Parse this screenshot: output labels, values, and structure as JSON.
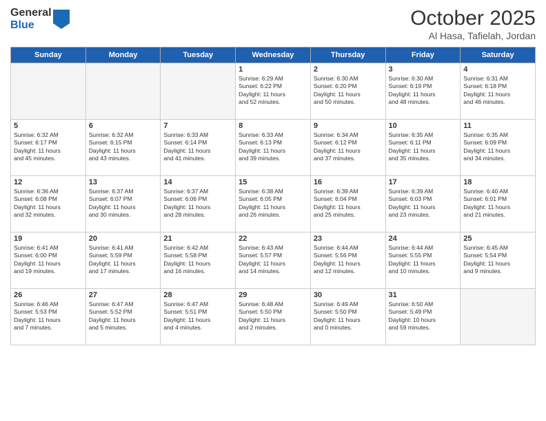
{
  "logo": {
    "general": "General",
    "blue": "Blue"
  },
  "header": {
    "month": "October 2025",
    "location": "Al Hasa, Tafielah, Jordan"
  },
  "weekdays": [
    "Sunday",
    "Monday",
    "Tuesday",
    "Wednesday",
    "Thursday",
    "Friday",
    "Saturday"
  ],
  "weeks": [
    [
      {
        "day": "",
        "info": ""
      },
      {
        "day": "",
        "info": ""
      },
      {
        "day": "",
        "info": ""
      },
      {
        "day": "1",
        "info": "Sunrise: 6:29 AM\nSunset: 6:22 PM\nDaylight: 11 hours\nand 52 minutes."
      },
      {
        "day": "2",
        "info": "Sunrise: 6:30 AM\nSunset: 6:20 PM\nDaylight: 11 hours\nand 50 minutes."
      },
      {
        "day": "3",
        "info": "Sunrise: 6:30 AM\nSunset: 6:19 PM\nDaylight: 11 hours\nand 48 minutes."
      },
      {
        "day": "4",
        "info": "Sunrise: 6:31 AM\nSunset: 6:18 PM\nDaylight: 11 hours\nand 46 minutes."
      }
    ],
    [
      {
        "day": "5",
        "info": "Sunrise: 6:32 AM\nSunset: 6:17 PM\nDaylight: 11 hours\nand 45 minutes."
      },
      {
        "day": "6",
        "info": "Sunrise: 6:32 AM\nSunset: 6:15 PM\nDaylight: 11 hours\nand 43 minutes."
      },
      {
        "day": "7",
        "info": "Sunrise: 6:33 AM\nSunset: 6:14 PM\nDaylight: 11 hours\nand 41 minutes."
      },
      {
        "day": "8",
        "info": "Sunrise: 6:33 AM\nSunset: 6:13 PM\nDaylight: 11 hours\nand 39 minutes."
      },
      {
        "day": "9",
        "info": "Sunrise: 6:34 AM\nSunset: 6:12 PM\nDaylight: 11 hours\nand 37 minutes."
      },
      {
        "day": "10",
        "info": "Sunrise: 6:35 AM\nSunset: 6:11 PM\nDaylight: 11 hours\nand 35 minutes."
      },
      {
        "day": "11",
        "info": "Sunrise: 6:35 AM\nSunset: 6:09 PM\nDaylight: 11 hours\nand 34 minutes."
      }
    ],
    [
      {
        "day": "12",
        "info": "Sunrise: 6:36 AM\nSunset: 6:08 PM\nDaylight: 11 hours\nand 32 minutes."
      },
      {
        "day": "13",
        "info": "Sunrise: 6:37 AM\nSunset: 6:07 PM\nDaylight: 11 hours\nand 30 minutes."
      },
      {
        "day": "14",
        "info": "Sunrise: 6:37 AM\nSunset: 6:06 PM\nDaylight: 11 hours\nand 28 minutes."
      },
      {
        "day": "15",
        "info": "Sunrise: 6:38 AM\nSunset: 6:05 PM\nDaylight: 11 hours\nand 26 minutes."
      },
      {
        "day": "16",
        "info": "Sunrise: 6:39 AM\nSunset: 6:04 PM\nDaylight: 11 hours\nand 25 minutes."
      },
      {
        "day": "17",
        "info": "Sunrise: 6:39 AM\nSunset: 6:03 PM\nDaylight: 11 hours\nand 23 minutes."
      },
      {
        "day": "18",
        "info": "Sunrise: 6:40 AM\nSunset: 6:01 PM\nDaylight: 11 hours\nand 21 minutes."
      }
    ],
    [
      {
        "day": "19",
        "info": "Sunrise: 6:41 AM\nSunset: 6:00 PM\nDaylight: 11 hours\nand 19 minutes."
      },
      {
        "day": "20",
        "info": "Sunrise: 6:41 AM\nSunset: 5:59 PM\nDaylight: 11 hours\nand 17 minutes."
      },
      {
        "day": "21",
        "info": "Sunrise: 6:42 AM\nSunset: 5:58 PM\nDaylight: 11 hours\nand 16 minutes."
      },
      {
        "day": "22",
        "info": "Sunrise: 6:43 AM\nSunset: 5:57 PM\nDaylight: 11 hours\nand 14 minutes."
      },
      {
        "day": "23",
        "info": "Sunrise: 6:44 AM\nSunset: 5:56 PM\nDaylight: 11 hours\nand 12 minutes."
      },
      {
        "day": "24",
        "info": "Sunrise: 6:44 AM\nSunset: 5:55 PM\nDaylight: 11 hours\nand 10 minutes."
      },
      {
        "day": "25",
        "info": "Sunrise: 6:45 AM\nSunset: 5:54 PM\nDaylight: 11 hours\nand 9 minutes."
      }
    ],
    [
      {
        "day": "26",
        "info": "Sunrise: 6:46 AM\nSunset: 5:53 PM\nDaylight: 11 hours\nand 7 minutes."
      },
      {
        "day": "27",
        "info": "Sunrise: 6:47 AM\nSunset: 5:52 PM\nDaylight: 11 hours\nand 5 minutes."
      },
      {
        "day": "28",
        "info": "Sunrise: 6:47 AM\nSunset: 5:51 PM\nDaylight: 11 hours\nand 4 minutes."
      },
      {
        "day": "29",
        "info": "Sunrise: 6:48 AM\nSunset: 5:50 PM\nDaylight: 11 hours\nand 2 minutes."
      },
      {
        "day": "30",
        "info": "Sunrise: 6:49 AM\nSunset: 5:50 PM\nDaylight: 11 hours\nand 0 minutes."
      },
      {
        "day": "31",
        "info": "Sunrise: 6:50 AM\nSunset: 5:49 PM\nDaylight: 10 hours\nand 59 minutes."
      },
      {
        "day": "",
        "info": ""
      }
    ]
  ]
}
